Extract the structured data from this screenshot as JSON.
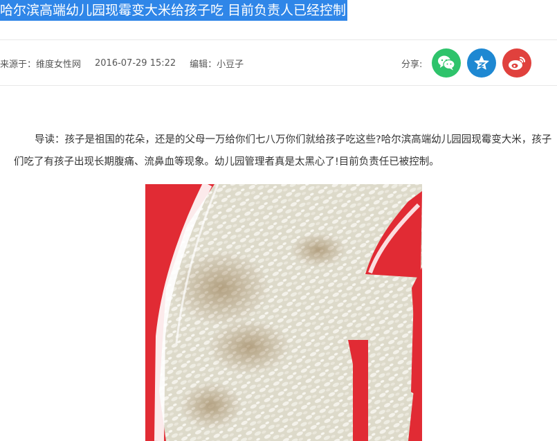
{
  "article": {
    "title": "哈尔滨高端幼儿园现霉变大米给孩子吃 目前负责人已经控制",
    "source": "来源于：维度女性网",
    "datetime": "2016-07-29 15:22",
    "editor": "编辑：小豆子",
    "lead": "导读：孩子是祖国的花朵，还是的父母一万给你们七八万你们就给孩子吃这些?哈尔滨高端幼儿园园现霉变大米，孩子们吃了有孩子出现长期腹痛、流鼻血等现象。幼儿园管理者真是太黑心了!目前负责任已被控制。"
  },
  "share": {
    "label": "分享:",
    "buttons": [
      {
        "icon": "wechat-icon",
        "color": "#2ec36b"
      },
      {
        "icon": "star-icon",
        "color": "#1e88d2"
      },
      {
        "icon": "weibo-icon",
        "color": "#e0413d"
      }
    ]
  },
  "colors": {
    "title_highlight": "#2f86e8",
    "bag_red": "#e0202a"
  }
}
